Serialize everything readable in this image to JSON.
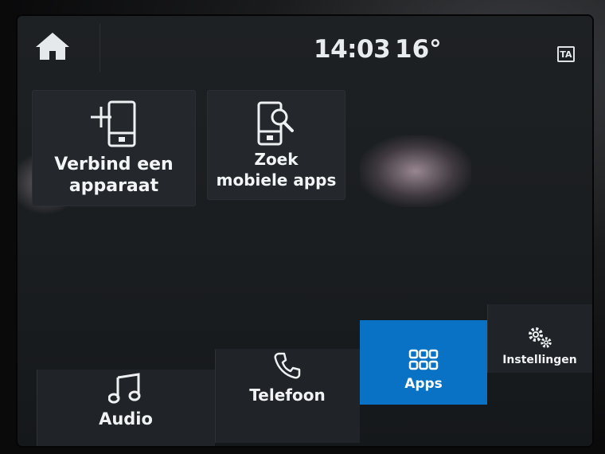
{
  "status": {
    "time": "14:03",
    "temperature": "16°",
    "ta_label": "TA"
  },
  "tiles": {
    "connect_label": "Verbind een\napparaat",
    "search_label": "Zoek\nmobiele apps"
  },
  "nav": {
    "audio": "Audio",
    "phone": "Telefoon",
    "apps": "Apps",
    "settings": "Instellingen"
  },
  "colors": {
    "active_accent": "#0a72c4",
    "background": "#1e2124",
    "text": "#e9ecef"
  },
  "icons": {
    "home": "home-icon",
    "connect": "add-phone-icon",
    "search": "phone-search-icon",
    "audio": "music-note-icon",
    "phone": "phone-handset-icon",
    "apps": "grid-icon",
    "settings": "gears-icon"
  }
}
